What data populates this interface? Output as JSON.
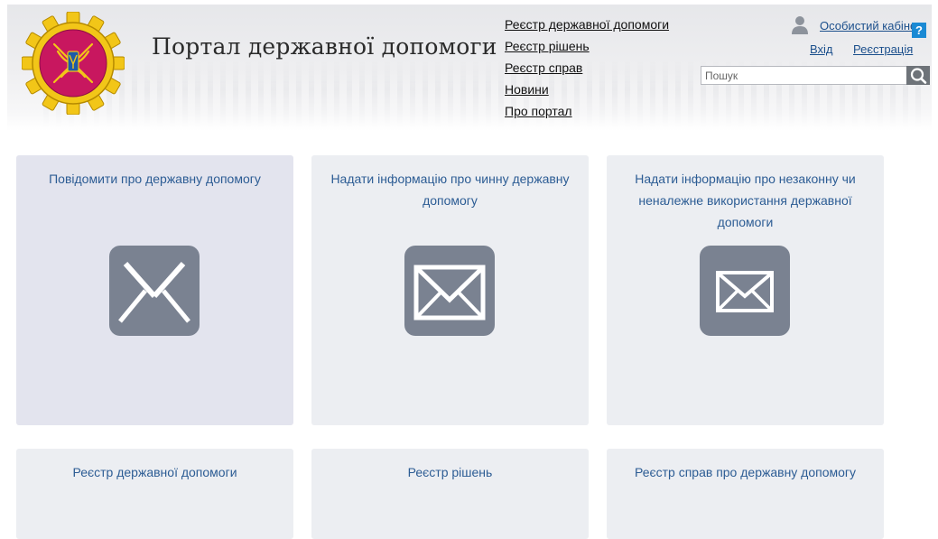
{
  "header": {
    "site_title": "Портал державної допомоги",
    "nav": [
      "Реєстр державної допомоги",
      "Реєстр рішень",
      "Реєстр справ",
      "Новини",
      "Про портал"
    ],
    "cabinet_label": "Особистий кабінет",
    "help_label": "?",
    "login_label": "Вхід",
    "register_label": "Реєстрація",
    "search_placeholder": "Пошук"
  },
  "tiles": [
    {
      "title": "Повідомити про державну допомогу",
      "icon": "envelope-open-icon"
    },
    {
      "title": "Надати інформацію про чинну державну допомогу",
      "icon": "envelope-icon"
    },
    {
      "title": "Надати інформацію про незаконну чи неналежне використання державної допомоги",
      "icon": "envelope-icon"
    },
    {
      "title": "Реєстр державної допомоги"
    },
    {
      "title": "Реєстр рішень"
    },
    {
      "title": "Реєстр справ про державну допомогу"
    }
  ],
  "colors": {
    "link": "#1b4f8c",
    "tile_title": "#2c5c94",
    "tile_bg": "#eceef2",
    "tile_active_bg": "#e3e4ee",
    "icon_bg": "#7a8291",
    "help_bg": "#1a8ad4",
    "logo_ring": "#f2c618",
    "logo_center": "#c8175f"
  }
}
